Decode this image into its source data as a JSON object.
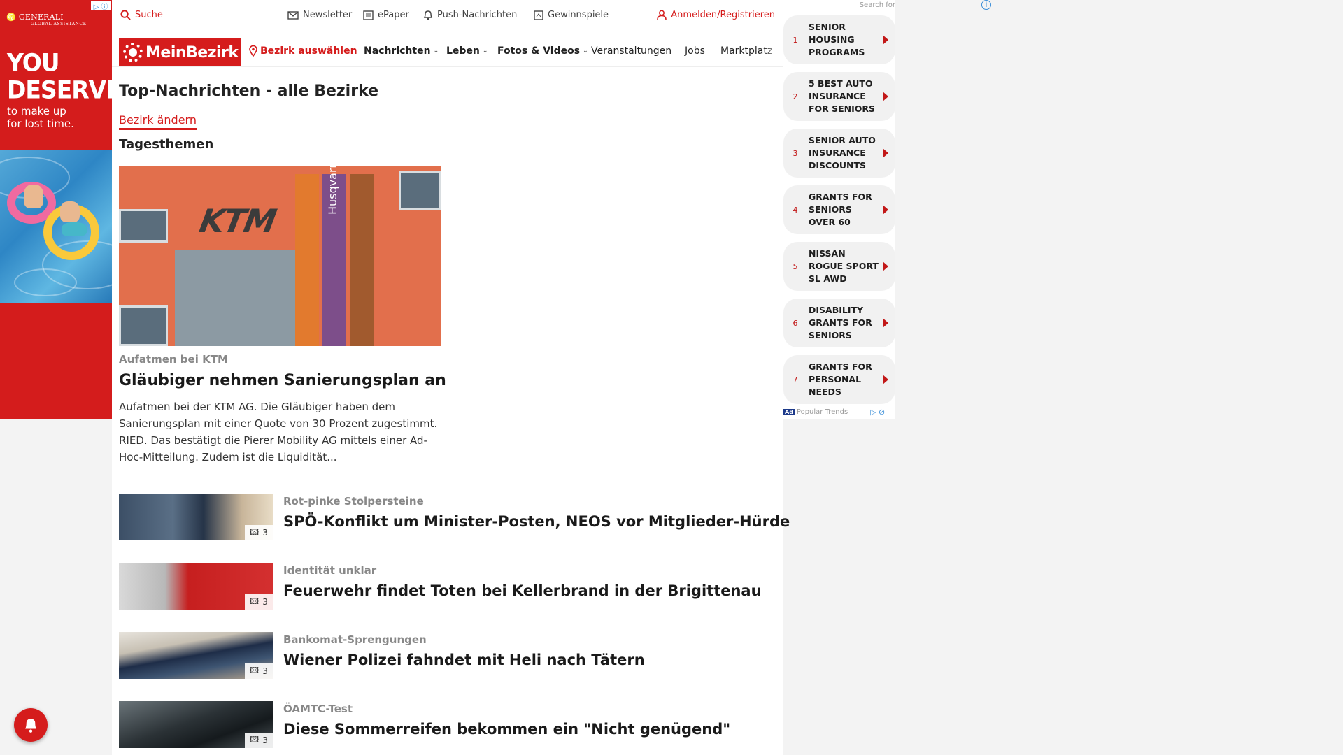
{
  "left_ad": {
    "brand": "GENERALI",
    "brand_sub": "GLOBAL ASSISTANCE",
    "headline_1": "YOU",
    "headline_2": "DESERVE",
    "sub_1": "to make up",
    "sub_2": "for lost time."
  },
  "topbar": {
    "search": "Suche",
    "newsletter": "Newsletter",
    "epaper": "ePaper",
    "push": "Push-Nachrichten",
    "gewinnspiele": "Gewinnspiele",
    "login": "Anmelden/Registrieren"
  },
  "nav": {
    "logo": "MeinBezirk",
    "bezirk": "Bezirk auswählen",
    "items": [
      "Nachrichten",
      "Leben",
      "Fotos & Videos",
      "Veranstaltungen",
      "Jobs",
      "Marktplatz"
    ]
  },
  "page": {
    "title": "Top-Nachrichten - alle Bezirke",
    "change_link": "Bezirk ändern",
    "section": "Tagesthemen"
  },
  "hero": {
    "image_text": "KTM",
    "flag_text": "Husqvarna",
    "kicker": "Aufatmen bei KTM",
    "title": "Gläubiger nehmen Sanierungsplan an",
    "teaser": "Aufatmen bei der KTM AG. Die Gläubiger haben dem Sanierungsplan mit einer Quote von 30 Prozent zugestimmt. RIED. Das bestätigt die Pierer Mobility AG mittels einer Ad-Hoc-Mitteilung. Zudem ist die Liquidität..."
  },
  "stories": [
    {
      "kicker": "Rot-pinke Stolpersteine",
      "title": "SPÖ-Konflikt um Minister-Posten, NEOS vor Mitglieder-Hürde",
      "count": "3"
    },
    {
      "kicker": "Identität unklar",
      "title": "Feuerwehr findet Toten bei Kellerbrand in der Brigittenau",
      "count": "3"
    },
    {
      "kicker": "Bankomat-Sprengungen",
      "title": "Wiener Polizei fahndet mit Heli nach Tätern",
      "count": "3"
    },
    {
      "kicker": "ÖAMTC-Test",
      "title": "Diese Sommerreifen bekommen ein \"Nicht genügend\"",
      "count": "3"
    }
  ],
  "right_ad": {
    "search_for": "Search for",
    "items": [
      {
        "n": "1",
        "label": "SENIOR HOUSING PROGRAMS"
      },
      {
        "n": "2",
        "label": "5 BEST AUTO INSURANCE FOR SENIORS"
      },
      {
        "n": "3",
        "label": "SENIOR AUTO INSURANCE DISCOUNTS"
      },
      {
        "n": "4",
        "label": "GRANTS FOR SENIORS OVER 60"
      },
      {
        "n": "5",
        "label": "NISSAN ROGUE SPORT SL AWD"
      },
      {
        "n": "6",
        "label": "DISABILITY GRANTS FOR SENIORS"
      },
      {
        "n": "7",
        "label": "GRANTS FOR PERSONAL NEEDS"
      }
    ],
    "footer_badge": "Ad",
    "footer": "Popular Trends"
  },
  "colors": {
    "brand_red": "#d51c1c",
    "ad_red": "#d41c1c",
    "arrow_red": "#c21818"
  }
}
